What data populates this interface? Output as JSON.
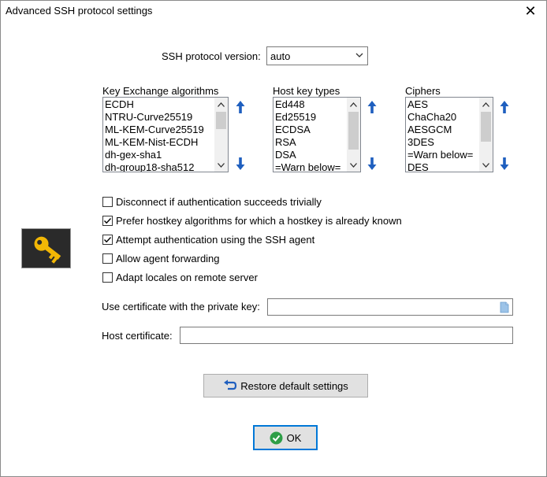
{
  "window": {
    "title": "Advanced SSH protocol settings",
    "close_glyph": "✕"
  },
  "protocol": {
    "label": "SSH protocol version:",
    "value": "auto"
  },
  "kex": {
    "label": "Key Exchange algorithms",
    "items": [
      "ECDH",
      "NTRU-Curve25519",
      "ML-KEM-Curve25519",
      "ML-KEM-Nist-ECDH",
      "dh-gex-sha1",
      "dh-group18-sha512"
    ]
  },
  "hostkeys": {
    "label": "Host key types",
    "items": [
      "Ed448",
      "Ed25519",
      "ECDSA",
      "RSA",
      "DSA",
      "=Warn below="
    ]
  },
  "ciphers": {
    "label": "Ciphers",
    "items": [
      "AES",
      "ChaCha20",
      "AESGCM",
      "3DES",
      "=Warn below=",
      "DES"
    ]
  },
  "options": {
    "disconnect_trivial": {
      "label": "Disconnect if authentication succeeds trivially",
      "checked": false
    },
    "prefer_known_hostkey": {
      "label": "Prefer hostkey algorithms for which a hostkey is already known",
      "checked": true
    },
    "ssh_agent_auth": {
      "label": "Attempt authentication using the SSH agent",
      "checked": true
    },
    "agent_forwarding": {
      "label": "Allow agent forwarding",
      "checked": false
    },
    "adapt_locales": {
      "label": "Adapt locales on remote server",
      "checked": false
    }
  },
  "certificate": {
    "label": "Use certificate with the private key:",
    "value": ""
  },
  "host_certificate": {
    "label": "Host certificate:",
    "value": ""
  },
  "buttons": {
    "restore": "Restore default settings",
    "ok": "OK"
  },
  "colors": {
    "arrow_blue": "#1f5fbf",
    "ok_green": "#2e9e47",
    "key_gold": "#f2b705",
    "key_bg": "#2a2a2a"
  }
}
